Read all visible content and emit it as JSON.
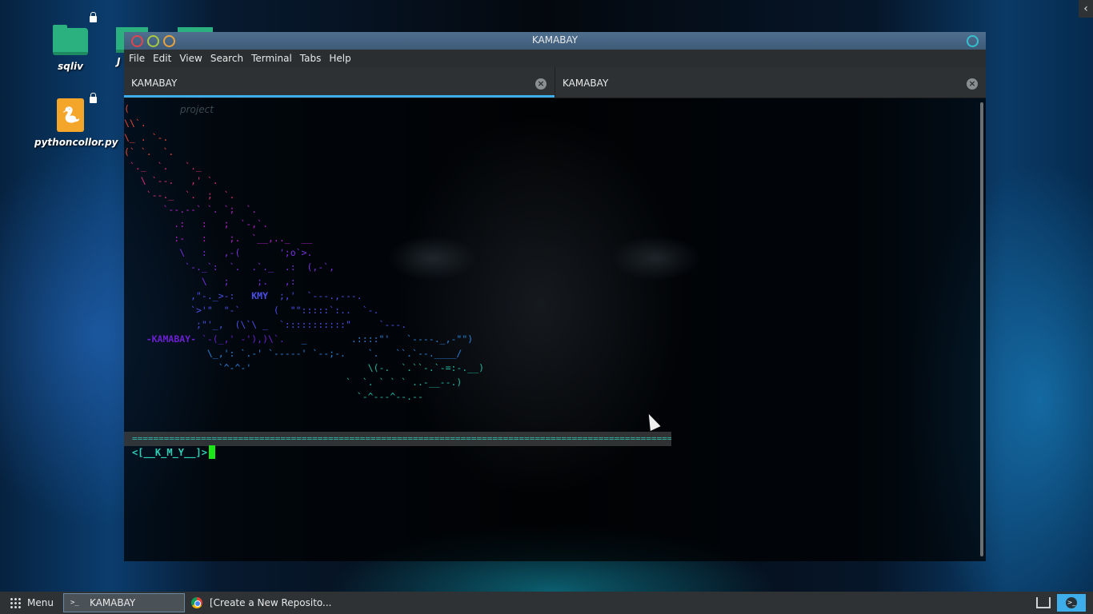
{
  "desktop": {
    "icons": [
      {
        "label": "sqliv",
        "type": "folder-icon"
      },
      {
        "label": "J",
        "type": "folder-icon"
      },
      {
        "label": "pythoncollor.py",
        "type": "python-file-icon"
      }
    ]
  },
  "window": {
    "title": "KAMABAY",
    "controls": {
      "close_color": "#e0464b",
      "minimize_color": "#a9c940",
      "maximize_color": "#e8a33d",
      "extra_color": "#35c0d0"
    },
    "menu": [
      "File",
      "Edit",
      "View",
      "Search",
      "Terminal",
      "Tabs",
      "Help"
    ],
    "tabs": [
      {
        "label": "KAMABAY",
        "active": true
      },
      {
        "label": "KAMABAY",
        "active": false
      }
    ]
  },
  "terminal": {
    "watermark": "project",
    "art_label_kamabay": "-KAMABAY-",
    "art_label_kmy": "KMY",
    "rule": "==========================================================================================================",
    "prompt": "<[__K_M_Y__]>"
  },
  "taskbar": {
    "menu_label": "Menu",
    "tasks": [
      {
        "label": "KAMABAY",
        "icon": "terminal-icon",
        "active": true
      },
      {
        "label": "[Create a New Reposito...",
        "icon": "chrome-icon",
        "active": false
      }
    ]
  },
  "colors": {
    "accent": "#3daee9",
    "prompt": "#2fd0b8",
    "cursor": "#1ae61a"
  }
}
